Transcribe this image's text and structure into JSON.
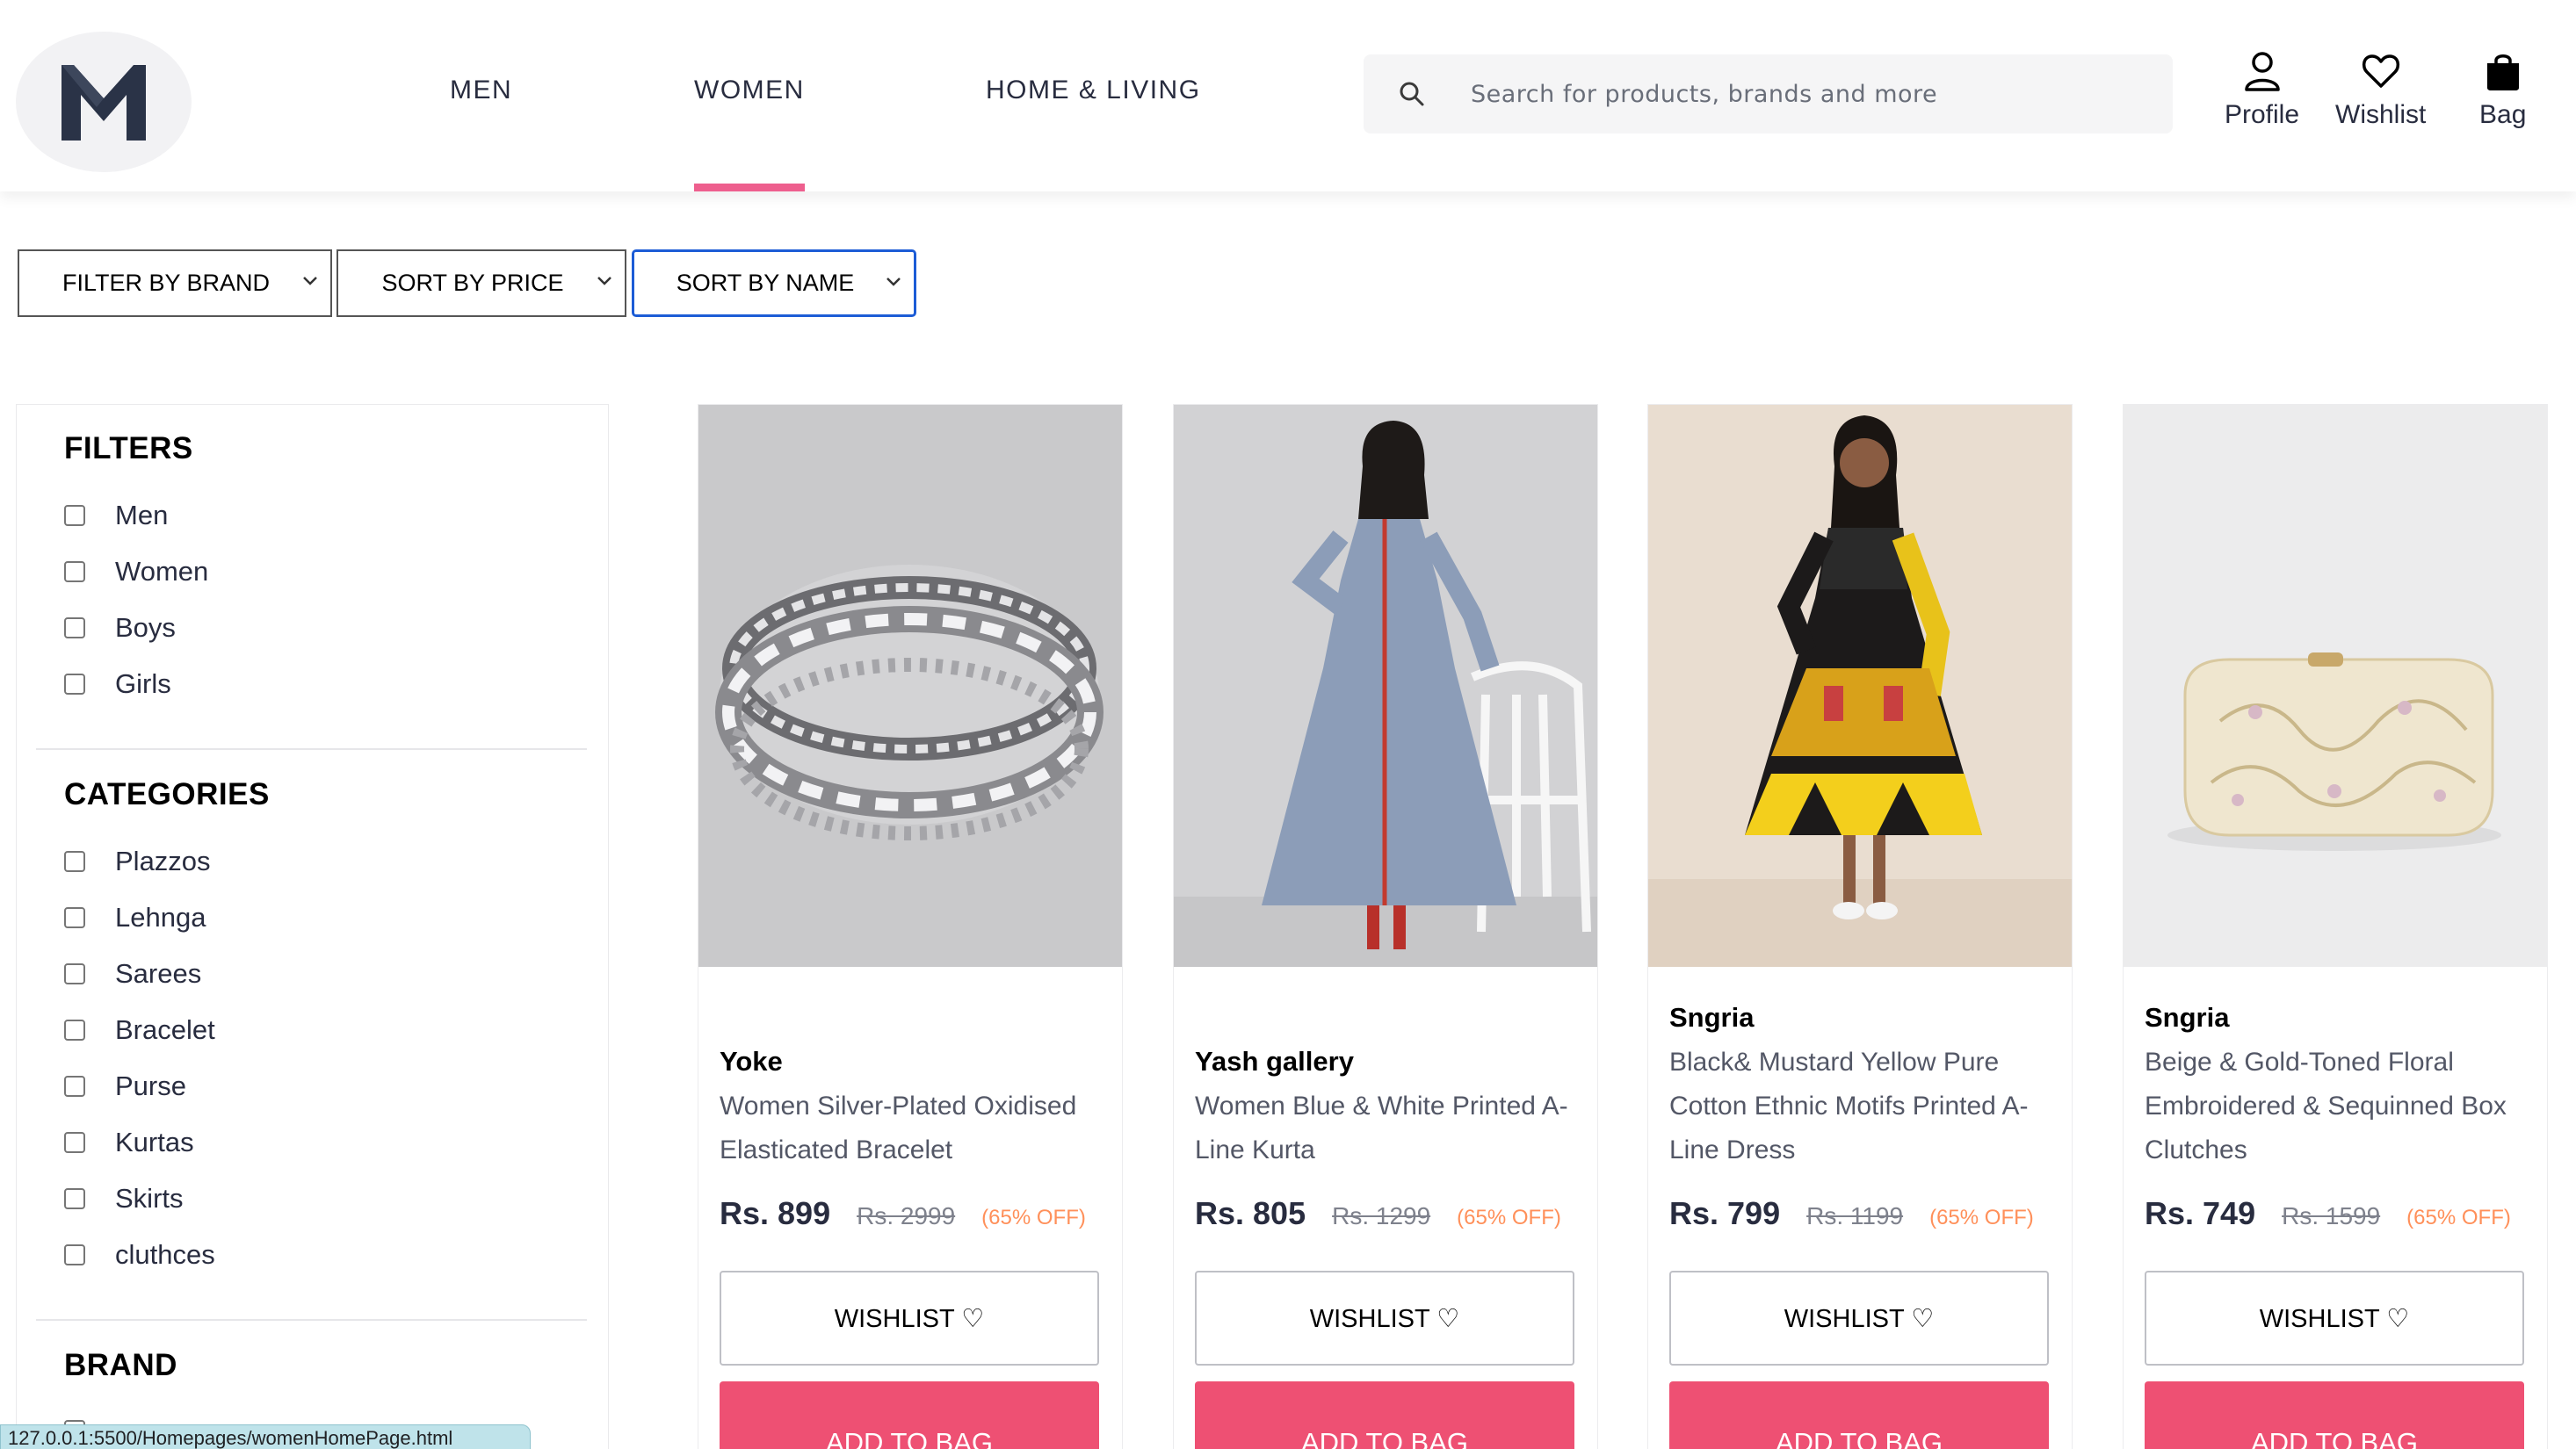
{
  "header": {
    "logo_letter": "M",
    "nav": [
      {
        "label": "MEN",
        "active": false
      },
      {
        "label": "WOMEN",
        "active": true
      },
      {
        "label": "HOME & LIVING",
        "active": false
      }
    ],
    "search_placeholder": "Search for products, brands and more",
    "actions": [
      {
        "label": "Profile",
        "icon": "user-icon"
      },
      {
        "label": "Wishlist",
        "icon": "heart-icon"
      },
      {
        "label": "Bag",
        "icon": "bag-icon"
      }
    ]
  },
  "toolbar": {
    "filter_brand": "FILTER BY BRAND",
    "sort_price": "SORT BY PRICE",
    "sort_name": "SORT BY NAME"
  },
  "filters": {
    "title": "FILTERS",
    "gender": [
      "Men",
      "Women",
      "Boys",
      "Girls"
    ],
    "categories_title": "CATEGORIES",
    "categories": [
      "Plazzos",
      "Lehnga",
      "Sarees",
      "Bracelet",
      "Purse",
      "Kurtas",
      "Skirts",
      "cluthces"
    ],
    "brand_title": "BRAND"
  },
  "products": [
    {
      "brand": "Yoke",
      "desc": "Women Silver-Plated Oxidised Elasticated Bracelet",
      "price": "Rs. 899",
      "mrp": "Rs. 2999",
      "off": "(65% OFF)"
    },
    {
      "brand": "Yash gallery",
      "desc": "Women Blue & White Printed A-Line Kurta",
      "price": "Rs. 805",
      "mrp": "Rs. 1299",
      "off": "(65% OFF)"
    },
    {
      "brand": "Sngria",
      "desc": "Black& Mustard Yellow Pure Cotton Ethnic Motifs Printed A-Line Dress",
      "price": "Rs. 799",
      "mrp": "Rs. 1199",
      "off": "(65% OFF)"
    },
    {
      "brand": "Sngria",
      "desc": "Beige & Gold-Toned Floral Embroidered & Sequinned Box Clutches",
      "price": "Rs. 749",
      "mrp": "Rs. 1599",
      "off": "(65% OFF)"
    }
  ],
  "buttons": {
    "wishlist": "WISHLIST ♡",
    "add_to_bag": "ADD TO BAG"
  },
  "status_url": "127.0.0.1:5500/Homepages/womenHomePage.html",
  "colors": {
    "accent_pink": "#ee5f8e",
    "bag_button": "#ee5073",
    "discount": "#ff905a",
    "focus_blue": "#1c5cd6"
  }
}
